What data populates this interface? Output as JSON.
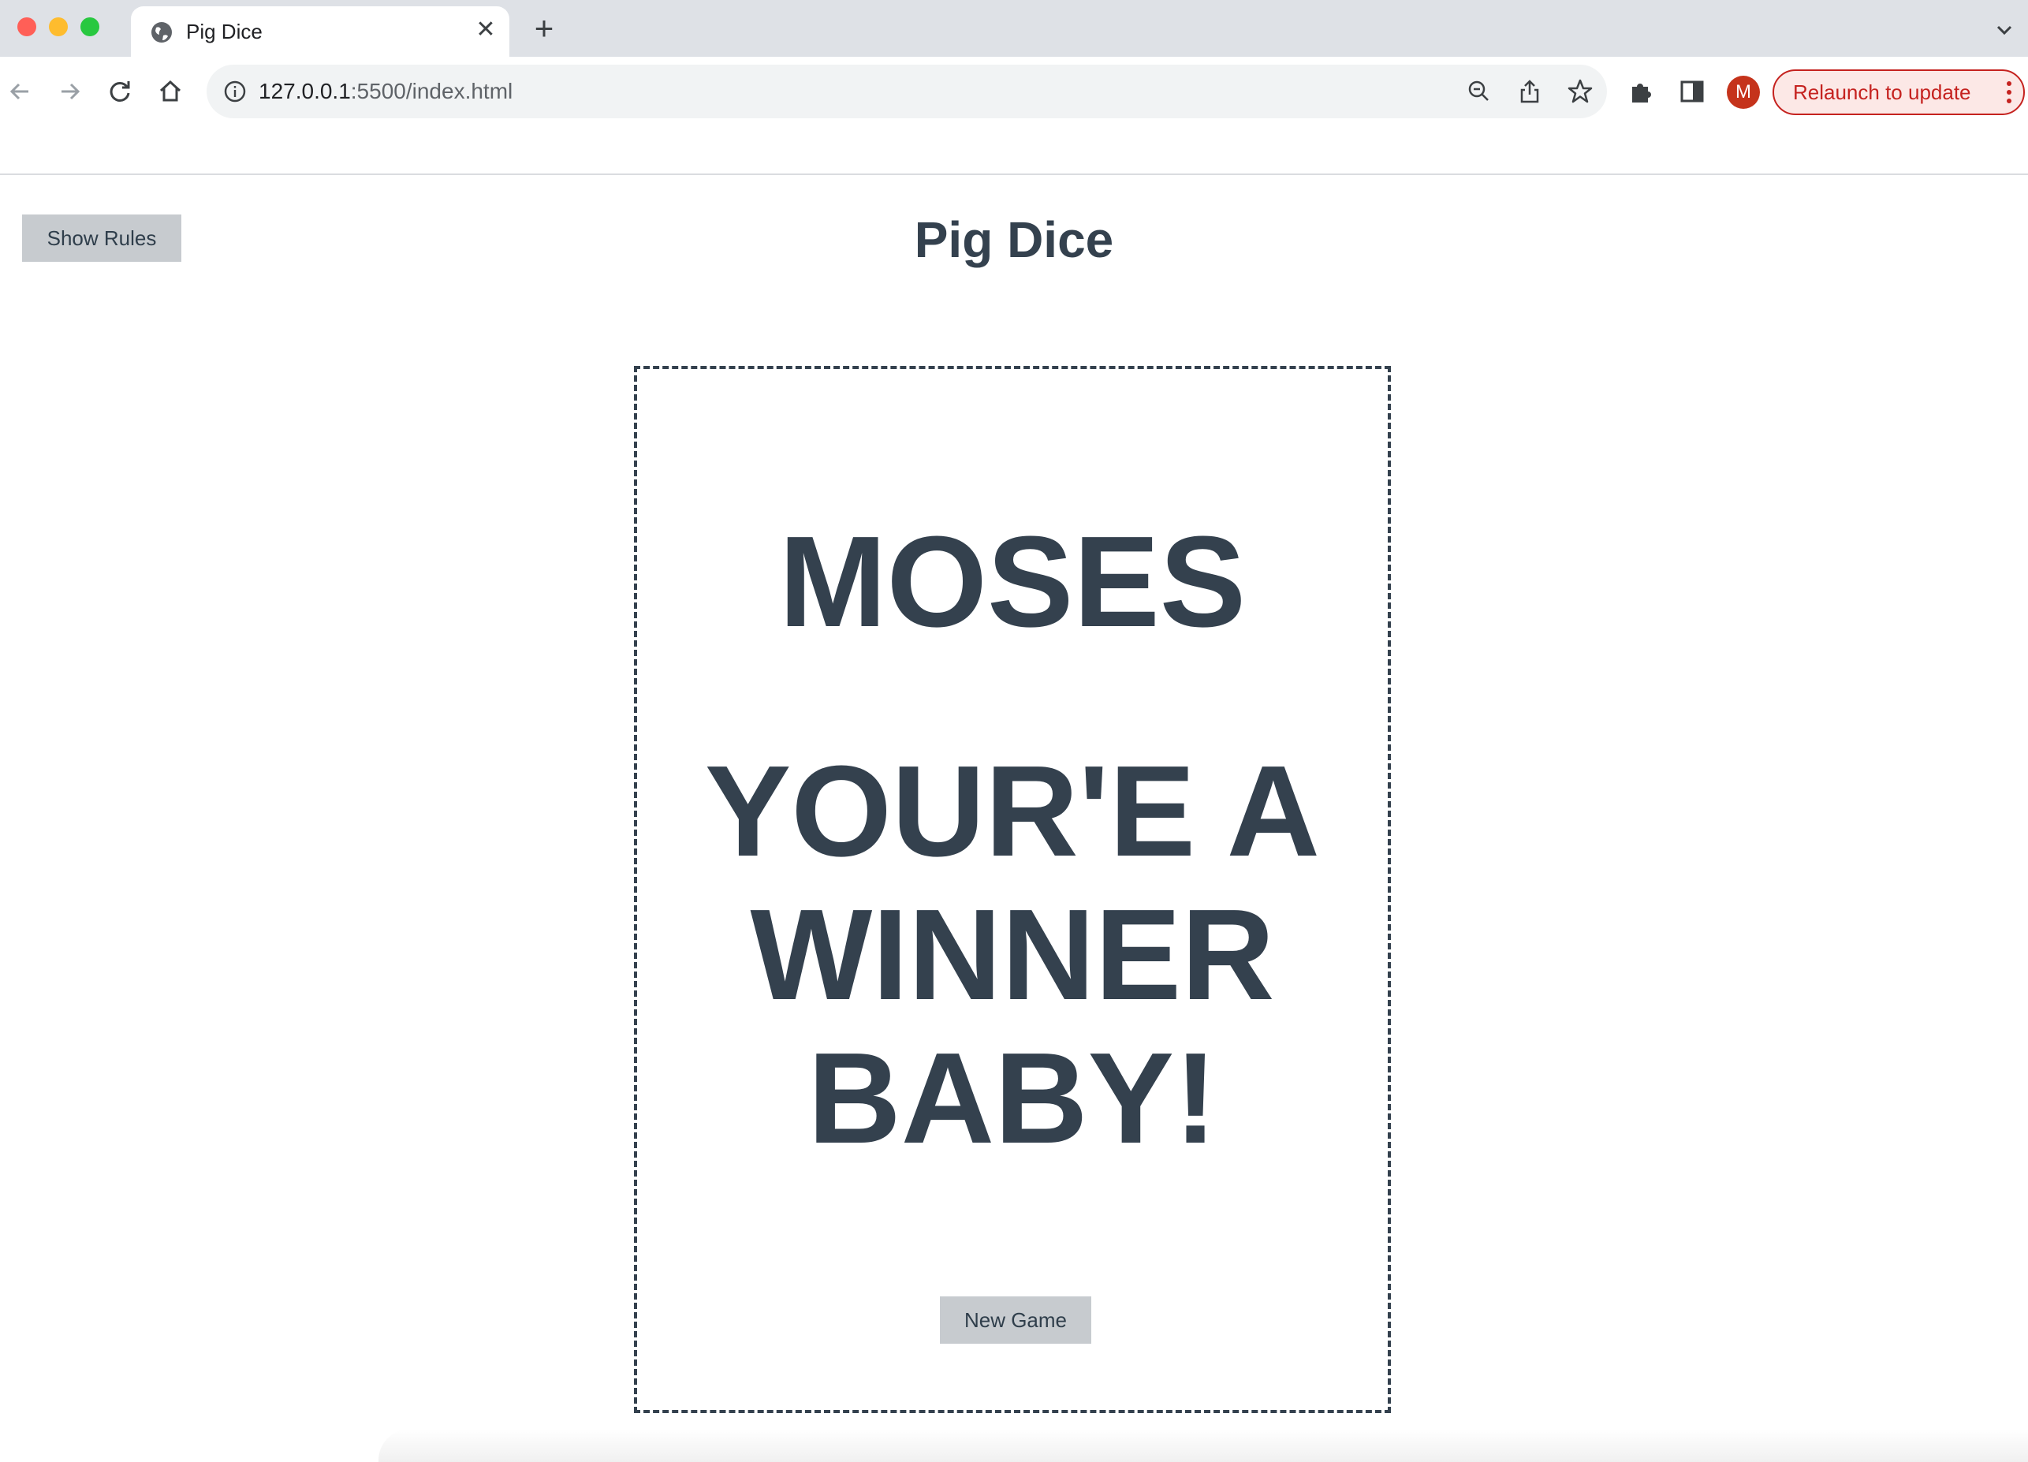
{
  "browser": {
    "tab_title": "Pig Dice",
    "tab_close": "✕",
    "new_tab": "+",
    "url_host": "127.0.0.1",
    "url_rest": ":5500/index.html",
    "avatar_letter": "M",
    "relaunch_label": "Relaunch to update",
    "icons": [
      "globe-icon",
      "back-icon",
      "forward-icon",
      "reload-icon",
      "home-icon",
      "info-icon",
      "zoom-out-icon",
      "share-icon",
      "bookmark-star-icon",
      "extensions-icon",
      "side-panel-icon",
      "more-vert-icon",
      "tab-search-icon"
    ],
    "accent_color": "#c5221f"
  },
  "page": {
    "show_rules_label": "Show Rules",
    "title": "Pig Dice",
    "winner_name": "MOSES",
    "winner_message": "YOUR'E A WINNER BABY!",
    "new_game_label": "New Game",
    "text_color": "#34414e",
    "button_color": "#c7cbcf"
  }
}
